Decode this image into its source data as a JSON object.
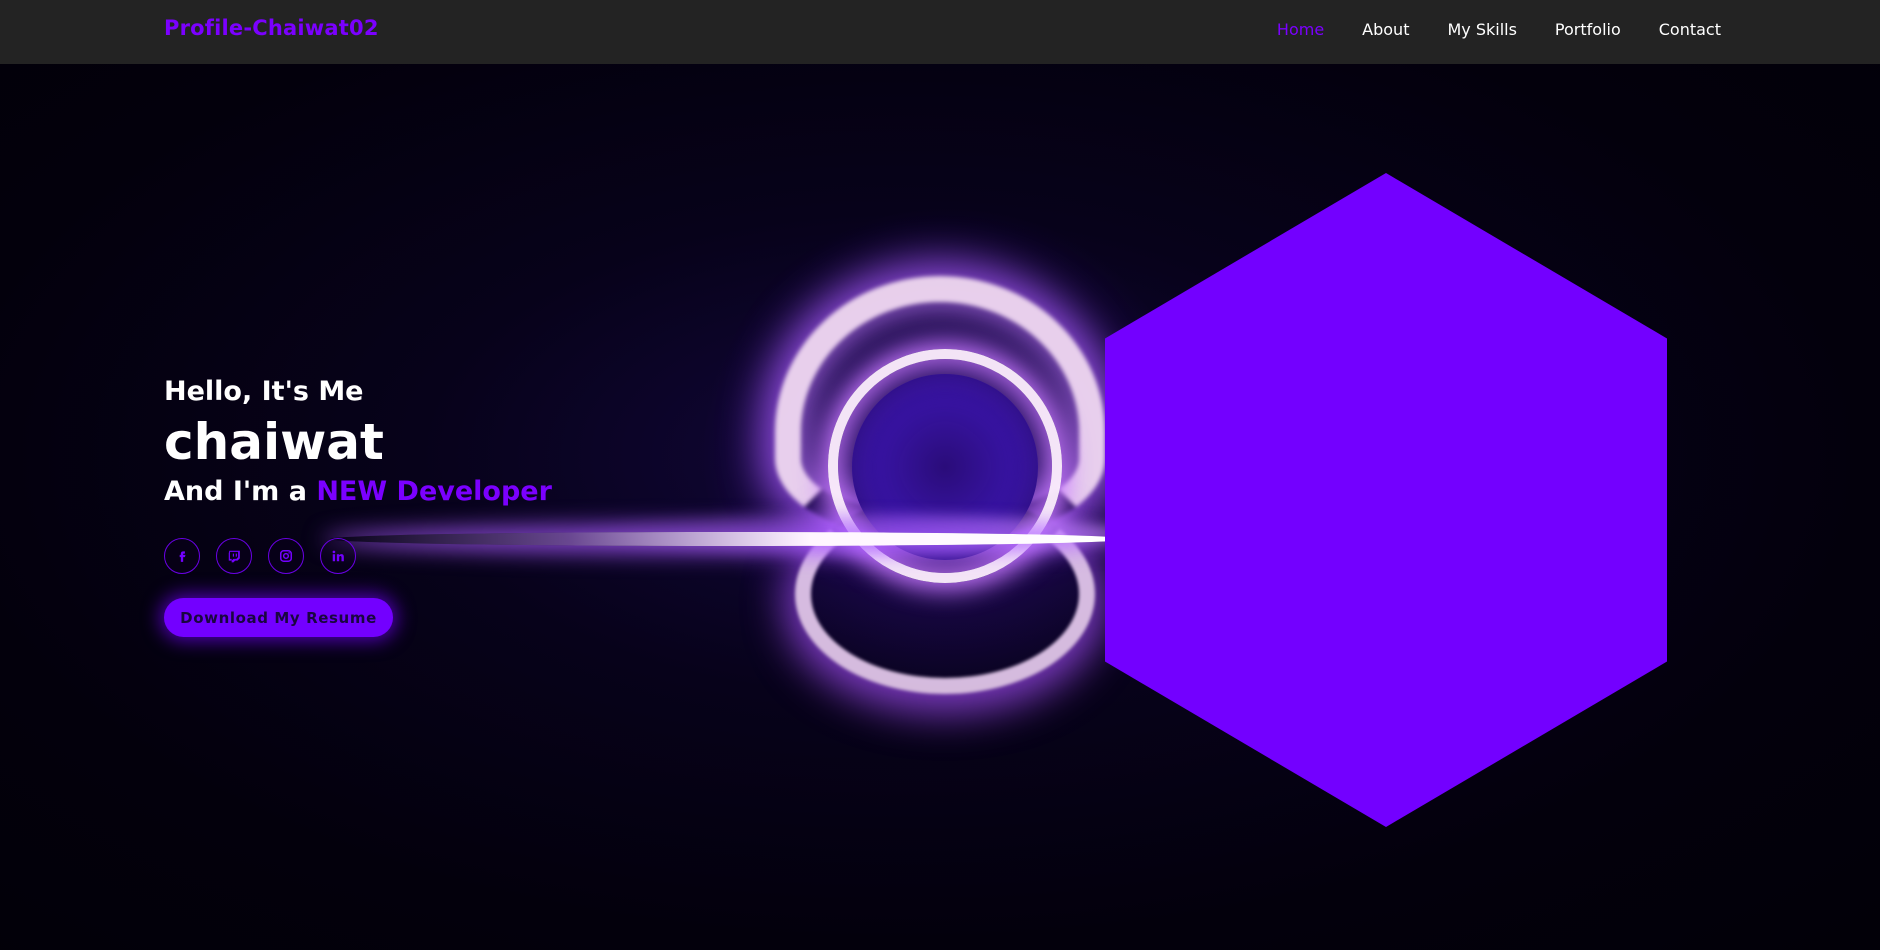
{
  "header": {
    "logo": "Profile-Chaiwat02",
    "nav": [
      {
        "label": "Home",
        "active": true
      },
      {
        "label": "About",
        "active": false
      },
      {
        "label": "My Skills",
        "active": false
      },
      {
        "label": "Portfolio",
        "active": false
      },
      {
        "label": "Contact",
        "active": false
      }
    ]
  },
  "hero": {
    "greeting": "Hello, It's Me",
    "name": "chaiwat",
    "role_prefix": "And I'm a ",
    "role_highlight": "NEW Developer",
    "socials": [
      {
        "icon": "facebook-icon"
      },
      {
        "icon": "twitch-icon"
      },
      {
        "icon": "instagram-icon"
      },
      {
        "icon": "linkedin-icon"
      }
    ],
    "resume_button": "Download My Resume"
  },
  "colors": {
    "accent": "#7300ff",
    "header_bg": "#232323",
    "page_bg": "#04000f"
  }
}
